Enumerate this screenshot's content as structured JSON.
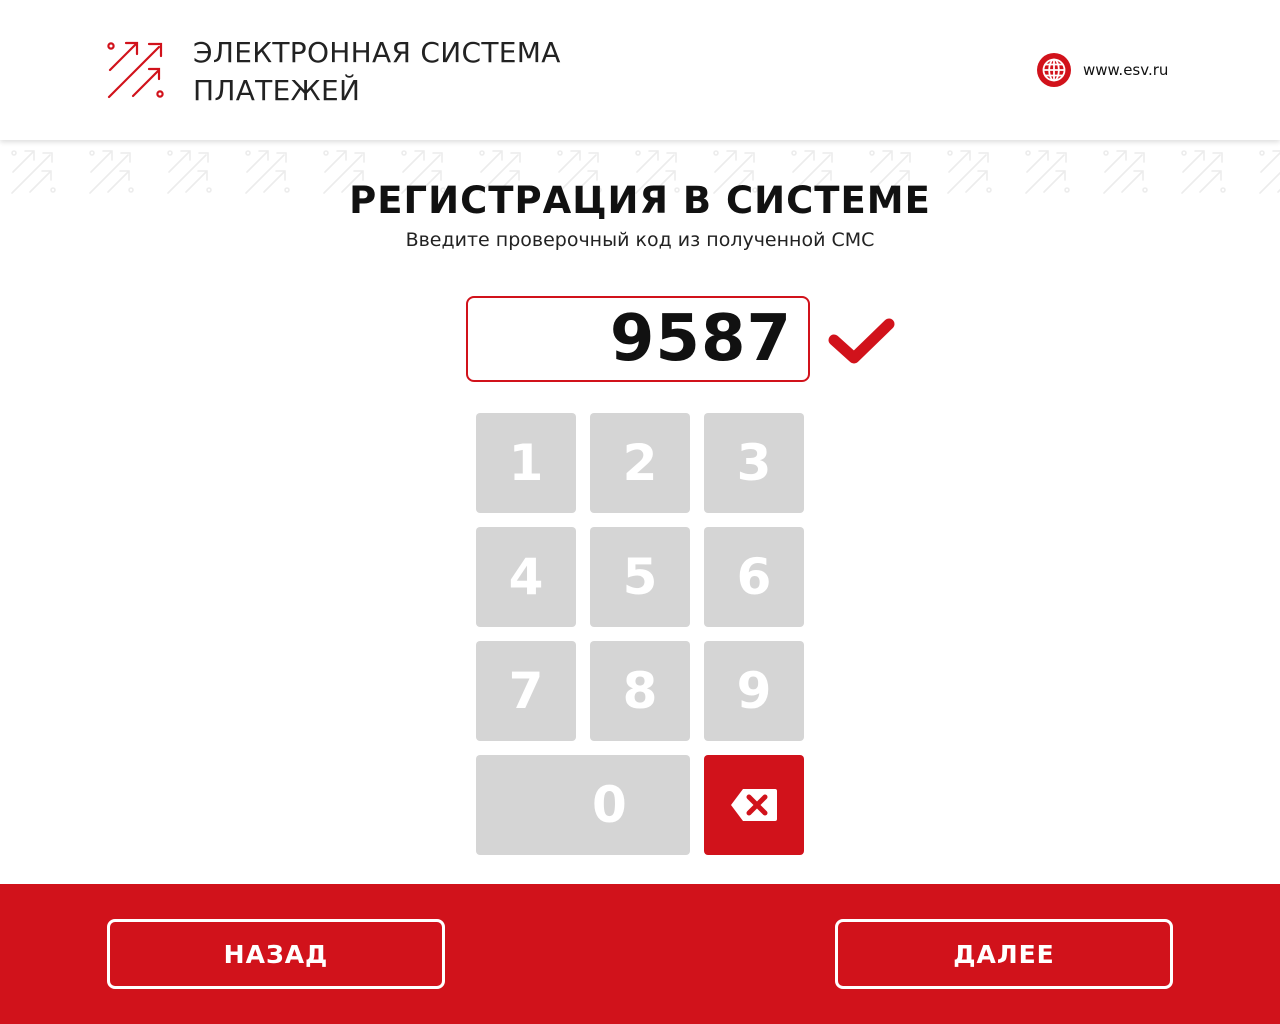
{
  "header": {
    "logo_icon": "arrows-logo-icon",
    "logo_line1": "ЭЛЕКТРОННАЯ СИСТЕМА",
    "logo_line2": "ПЛАТЕЖЕЙ",
    "website_icon": "globe-icon",
    "website": "www.esv.ru"
  },
  "main": {
    "title": "РЕГИСТРАЦИЯ В СИСТЕМЕ",
    "subtitle": "Введите проверочный код из полученной СМС",
    "code_value": "9587",
    "code_valid_icon": "check-icon"
  },
  "keypad": {
    "keys": [
      "1",
      "2",
      "3",
      "4",
      "5",
      "6",
      "7",
      "8",
      "9",
      "0"
    ],
    "backspace_icon": "backspace-icon"
  },
  "footer": {
    "back_label": "НАЗАД",
    "next_label": "ДАЛЕЕ"
  },
  "colors": {
    "accent": "#d1121b",
    "key_bg": "#d5d5d5",
    "key_text": "#ffffff",
    "text": "#111111"
  }
}
